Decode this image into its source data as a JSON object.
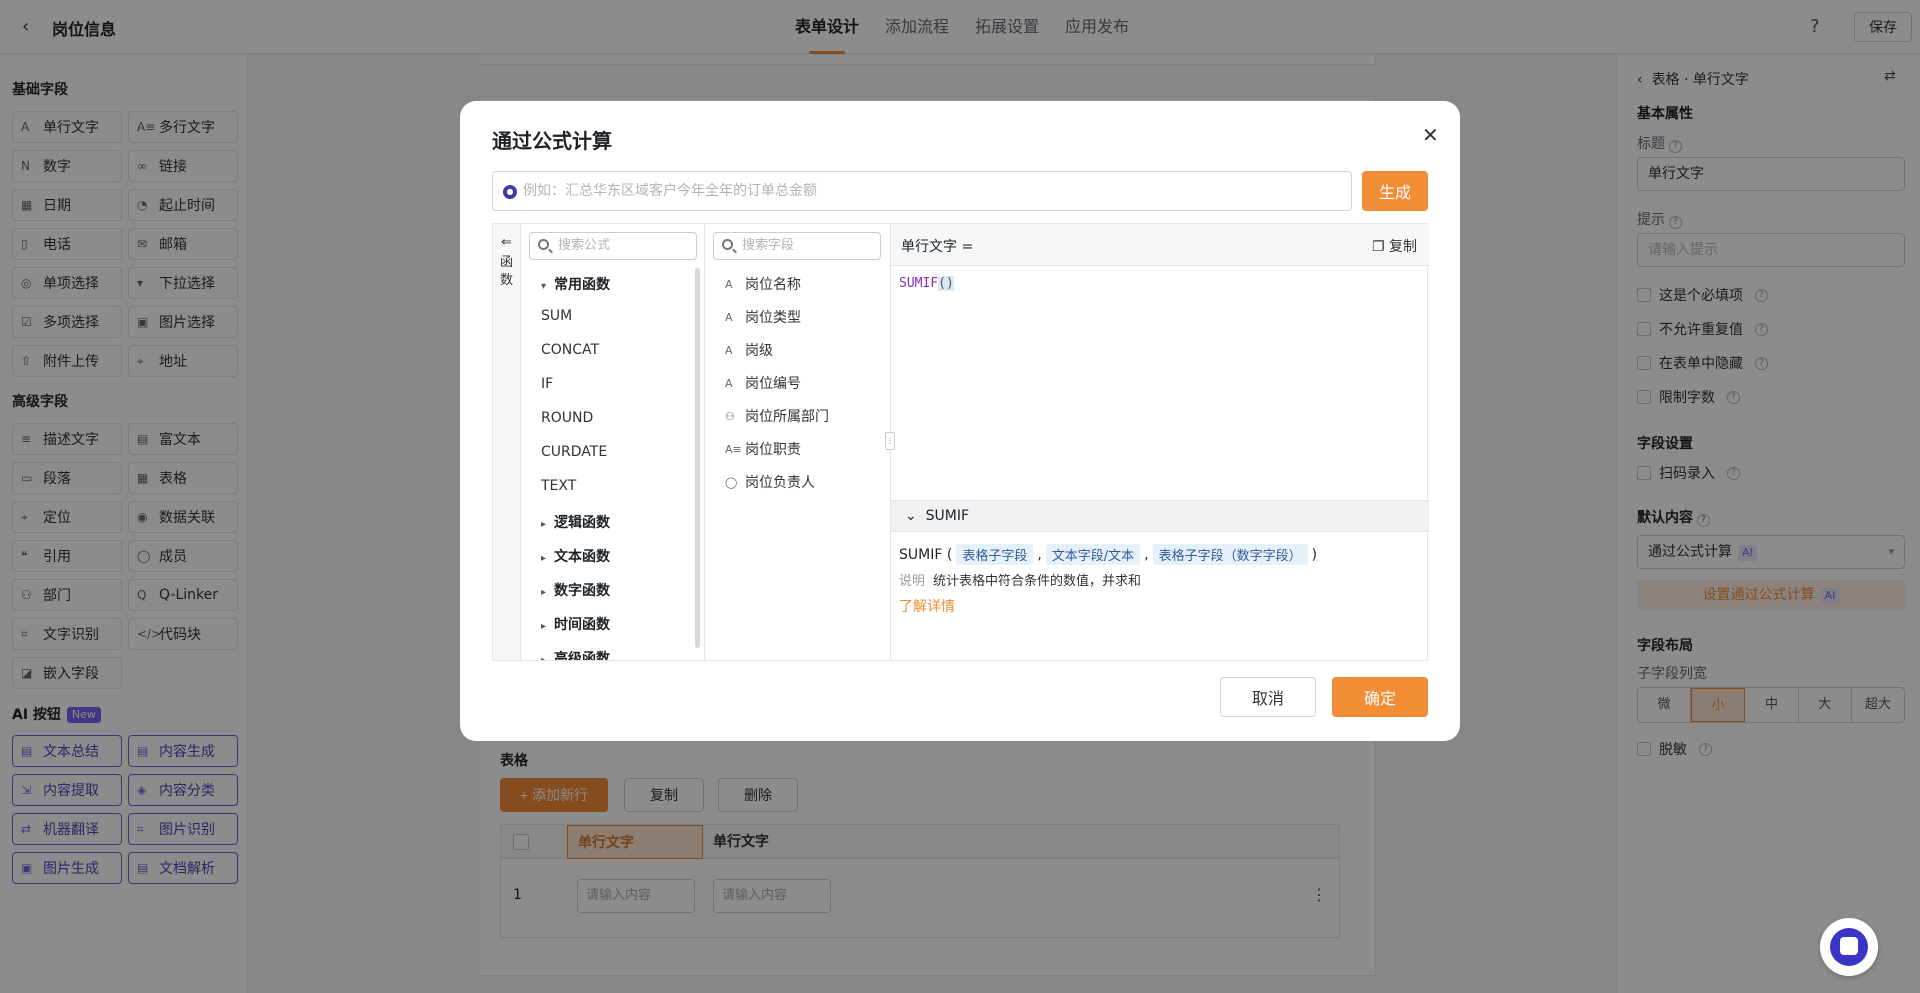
{
  "header": {
    "title": "岗位信息",
    "tabs": [
      "表单设计",
      "添加流程",
      "拓展设置",
      "应用发布"
    ],
    "save": "保存"
  },
  "sidebar": {
    "basic_title": "基础字段",
    "basic": [
      {
        "label": "单行文字",
        "icon": "A"
      },
      {
        "label": "多行文字",
        "icon": "A≡"
      },
      {
        "label": "数字",
        "icon": "N"
      },
      {
        "label": "链接",
        "icon": "∞"
      },
      {
        "label": "日期",
        "icon": "▦"
      },
      {
        "label": "起止时间",
        "icon": "◔"
      },
      {
        "label": "电话",
        "icon": "▯"
      },
      {
        "label": "邮箱",
        "icon": "✉"
      },
      {
        "label": "单项选择",
        "icon": "◎"
      },
      {
        "label": "下拉选择",
        "icon": "▾"
      },
      {
        "label": "多项选择",
        "icon": "☑"
      },
      {
        "label": "图片选择",
        "icon": "▣"
      },
      {
        "label": "附件上传",
        "icon": "⇧"
      },
      {
        "label": "地址",
        "icon": "⌖"
      }
    ],
    "adv_title": "高级字段",
    "advanced": [
      {
        "label": "描述文字",
        "icon": "≡"
      },
      {
        "label": "富文本",
        "icon": "▤"
      },
      {
        "label": "段落",
        "icon": "▭"
      },
      {
        "label": "表格",
        "icon": "▦"
      },
      {
        "label": "定位",
        "icon": "⌖"
      },
      {
        "label": "数据关联",
        "icon": "◉"
      },
      {
        "label": "引用",
        "icon": "❝"
      },
      {
        "label": "成员",
        "icon": "◯"
      },
      {
        "label": "部门",
        "icon": "⚇"
      },
      {
        "label": "Q-Linker",
        "icon": "Q"
      },
      {
        "label": "文字识别",
        "icon": "⌗"
      },
      {
        "label": "代码块",
        "icon": "</>"
      },
      {
        "label": "嵌入字段",
        "icon": "◪"
      }
    ],
    "ai_title": "AI 按钮",
    "ai_badge": "New",
    "ai": [
      {
        "label": "文本总结",
        "icon": "▤"
      },
      {
        "label": "内容生成",
        "icon": "▤"
      },
      {
        "label": "内容提取",
        "icon": "⇲"
      },
      {
        "label": "内容分类",
        "icon": "◈"
      },
      {
        "label": "机器翻译",
        "icon": "⇄"
      },
      {
        "label": "图片识别",
        "icon": "⌗"
      },
      {
        "label": "图片生成",
        "icon": "▣"
      },
      {
        "label": "文档解析",
        "icon": "▤"
      }
    ]
  },
  "canvas": {
    "table_label": "表格",
    "add_row": "+ 添加新行",
    "copy": "复制",
    "delete": "删除",
    "col1": "单行文字",
    "col2": "单行文字",
    "row_num": "1",
    "placeholder": "请输入内容",
    "more": "⋮"
  },
  "right": {
    "breadcrumb": "表格 · 单行文字",
    "basic": "基本属性",
    "title_label": "标题",
    "title_value": "单行文字",
    "hint_label": "提示",
    "hint_placeholder": "请输入提示",
    "checks": [
      "这是个必填项",
      "不允许重复值",
      "在表单中隐藏",
      "限制字数"
    ],
    "field_settings": "字段设置",
    "scan": "扫码录入",
    "default_content": "默认内容",
    "default_value": "通过公式计算",
    "ai_tag": "AI",
    "set_formula": "设置通过公式计算",
    "layout": "字段布局",
    "sub_width": "子字段列宽",
    "sizes": [
      "微",
      "小",
      "中",
      "大",
      "超大"
    ],
    "mask": "脱敏"
  },
  "dialog": {
    "title": "通过公式计算",
    "ai_placeholder": "例如：汇总华东区域客户今年全年的订单总金额",
    "generate": "生成",
    "rail_label": "函数",
    "fn_search": "搜索公式",
    "field_search": "搜索字段",
    "common_group": "常用函数",
    "common_fns": [
      "SUM",
      "CONCAT",
      "IF",
      "ROUND",
      "CURDATE",
      "TEXT"
    ],
    "groups": [
      "逻辑函数",
      "文本函数",
      "数字函数",
      "时间函数",
      "高级函数"
    ],
    "fields": [
      {
        "label": "岗位名称",
        "icon": "A"
      },
      {
        "label": "岗位类型",
        "icon": "A"
      },
      {
        "label": "岗级",
        "icon": "A"
      },
      {
        "label": "岗位编号",
        "icon": "A"
      },
      {
        "label": "岗位所属部门",
        "icon": "⚇"
      },
      {
        "label": "岗位职责",
        "icon": "A≡"
      },
      {
        "label": "岗位负责人",
        "icon": "◯"
      }
    ],
    "editor_label": "单行文字 =",
    "copy": "复制",
    "code_fn": "SUMIF",
    "code_paren": "()",
    "help_title": "SUMIF",
    "sig_fn": "SUMIF (",
    "sig_args": [
      "表格子字段",
      "文本字段/文本",
      "表格子字段（数字字段）"
    ],
    "sig_comma": ",",
    "sig_close": ")",
    "desc_key": "说明",
    "desc_text": "统计表格中符合条件的数值，并求和",
    "more": "了解详情",
    "cancel": "取消",
    "ok": "确定"
  }
}
